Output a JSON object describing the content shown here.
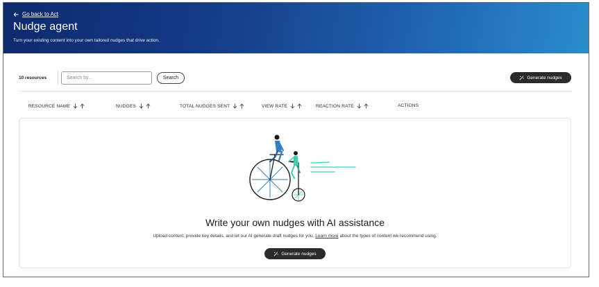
{
  "header": {
    "back_label": "Go back to Act",
    "title": "Nudge agent",
    "subtitle": "Turn your existing content into your own tailored nudges that drive action."
  },
  "toolbar": {
    "resource_count": "10 resources",
    "search_placeholder": "Search by...",
    "search_button": "Search",
    "generate_button": "Generate nudges"
  },
  "table": {
    "columns": [
      {
        "label": "RESOURCE NAME",
        "sortable": true
      },
      {
        "label": "NUDGES",
        "sortable": true
      },
      {
        "label": "TOTAL NUDGES SENT",
        "sortable": true
      },
      {
        "label": "VIEW RATE",
        "sortable": true
      },
      {
        "label": "REACTION RATE",
        "sortable": true
      },
      {
        "label": "ACTIONS",
        "sortable": false
      }
    ]
  },
  "empty_state": {
    "title": "Write your own nudges with AI assistance",
    "description_before": "Upload content, provide key details, and let our AI generate draft nudges for you.",
    "link": "Learn more",
    "description_after": "about the types of content we recommend using.",
    "button": "Generate nudges"
  },
  "colors": {
    "header_start": "#0f2a6d",
    "header_end": "#2a8ccc",
    "button_dark": "#2b2b2b",
    "illustration_blue": "#2f7fc1",
    "illustration_teal": "#3ecfb2"
  }
}
